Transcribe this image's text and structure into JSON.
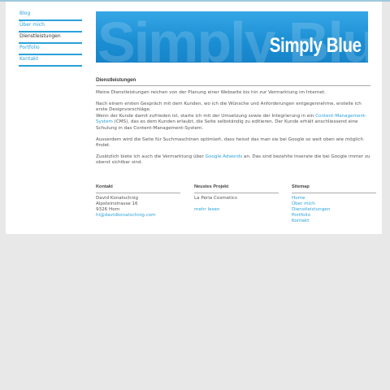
{
  "nav": {
    "items": [
      {
        "label": "Blog"
      },
      {
        "label": "Über mich"
      },
      {
        "label": "Dienstleistungen"
      },
      {
        "label": "Portfolio"
      },
      {
        "label": "Kontakt"
      }
    ]
  },
  "banner": {
    "ghost_text": "Simply Blue",
    "title": "Simply Blue"
  },
  "content": {
    "heading": "Dienstleistungen",
    "p1": "Meine Dienstleistungen reichen von der Planung einer Webseite bis hin zur Vermarktung im Internet.",
    "p2a": "Nach einem ersten Gespräch mit dem Kunden, wo ich die Wünsche und Anforderungen entgegennehme, erstelle ich erste Designvorschläge.",
    "p2b_pre": "Wenn der Kunde damit zufrieden ist, starte ich mit der Umsetzung sowie der Integrierung in ein ",
    "p2b_link": "Content-Management-System",
    "p2b_post": " (CMS), das es dem Kunden erlaubt, die Seite selbständig zu editieren. Der Kunde erhält anschliessend eine Schulung in das Content-Management-System.",
    "p3": "Ausserdem wird die Seite für Suchmaschinen optimiert, dass heisst das man sie bei Google so weit oben wie möglich findet.",
    "p4_pre": "Zusätzlich biete ich auch die Vermarktung über ",
    "p4_link": "Google Adwords",
    "p4_post": " an. Das sind bezahlte Inserate die bei Google immer zu oberst sichtbar sind."
  },
  "footer": {
    "contact": {
      "heading": "Kontakt",
      "name": "David Konatschnig",
      "street": "Alpsteinstrasse 16",
      "city": "9326 Horn",
      "email": "hi@davidkonatschnig.com"
    },
    "project": {
      "heading": "Neustes Projekt",
      "name": "La Perla Cosmetics",
      "more": "mehr lesen"
    },
    "sitemap": {
      "heading": "Sitemap",
      "links": [
        "Home",
        "Über mich",
        "Dienstleistungen",
        "Portfolio",
        "Kontakt"
      ]
    }
  }
}
